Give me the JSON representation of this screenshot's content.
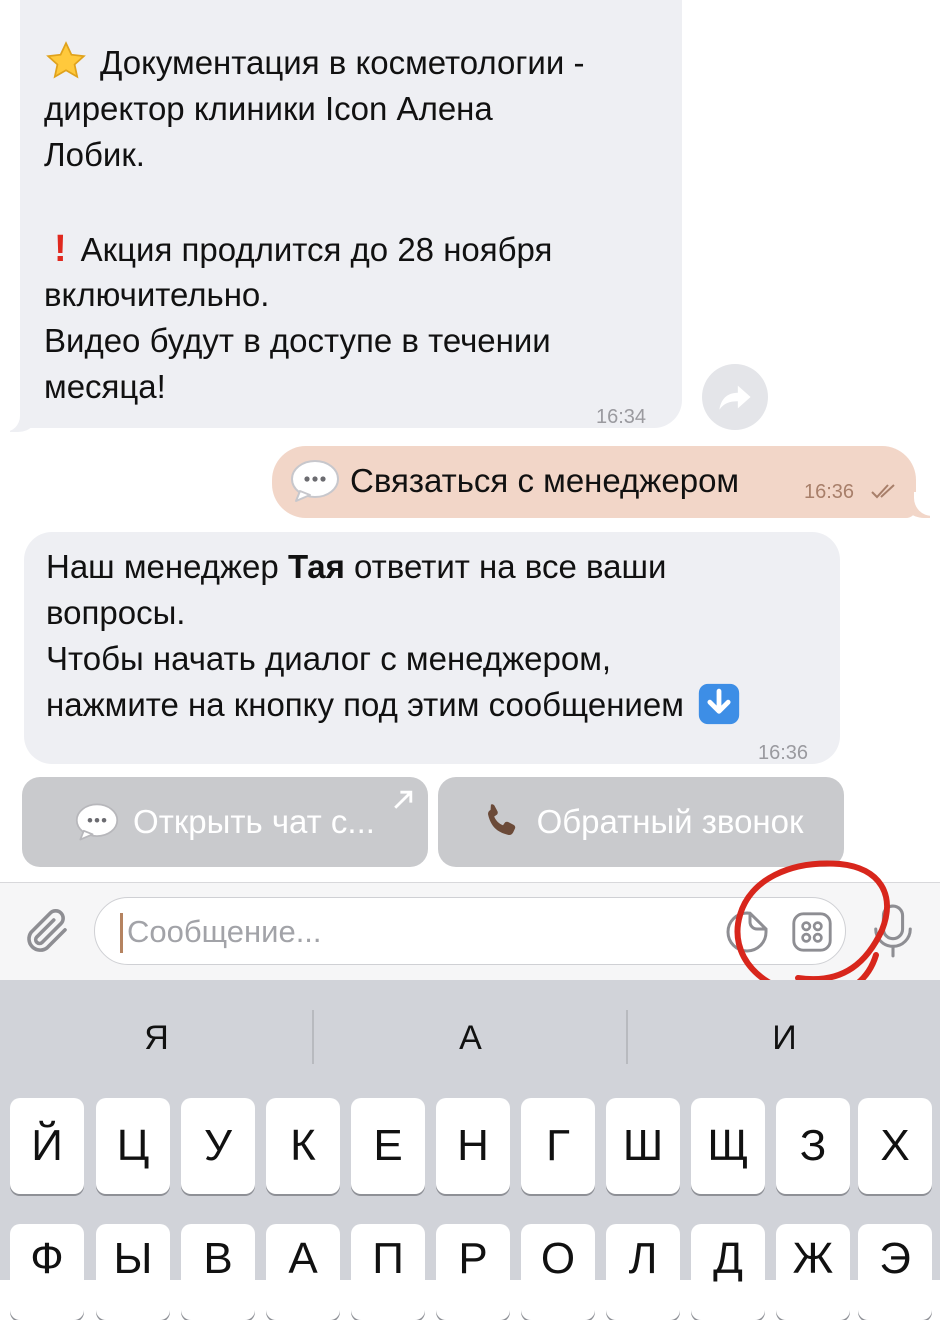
{
  "messages": {
    "promo": {
      "line1": "Документация в косметологии -",
      "line2": "директор клиники Icon Алена",
      "line3": "Лобик.",
      "line4": "Акция продлится до 28 ноября",
      "line5": "включительно.",
      "line6": "Видео будут в доступе в течении",
      "line7": "месяца!",
      "time": "16:34"
    },
    "outgoing": {
      "text": "Связаться с менеджером",
      "time": "16:36"
    },
    "reply": {
      "line1_pre": "Наш менеджер ",
      "line1_bold": "Тая",
      "line1_post": " ответит на все ваши",
      "line2": "вопросы.",
      "line3": "Чтобы начать диалог с менеджером,",
      "line4": "нажмите на кнопку под этим сообщением",
      "time": "16:36"
    }
  },
  "inline_buttons": {
    "open_chat": "Открыть чат с...",
    "callback": "Обратный звонок"
  },
  "composer": {
    "placeholder": "Сообщение..."
  },
  "keyboard": {
    "suggestions": [
      "Я",
      "А",
      "И"
    ],
    "row1": [
      "Й",
      "Ц",
      "У",
      "К",
      "Е",
      "Н",
      "Г",
      "Ш",
      "Щ",
      "З",
      "Х"
    ],
    "row2": [
      "Ф",
      "Ы",
      "В",
      "А",
      "П",
      "Р",
      "О",
      "Л",
      "Д",
      "Ж",
      "Э"
    ]
  },
  "colors": {
    "incoming_bubble": "#eeeff3",
    "outgoing_bubble": "#f2d6c8",
    "annotation_circle": "#d8261c"
  },
  "icons": [
    "star-icon",
    "exclamation-icon",
    "forward-icon",
    "speech-bubble-icon",
    "down-arrow-icon",
    "phone-icon",
    "external-link-icon",
    "paperclip-icon",
    "sticker-icon",
    "bot-menu-icon",
    "microphone-icon",
    "double-check-icon"
  ]
}
